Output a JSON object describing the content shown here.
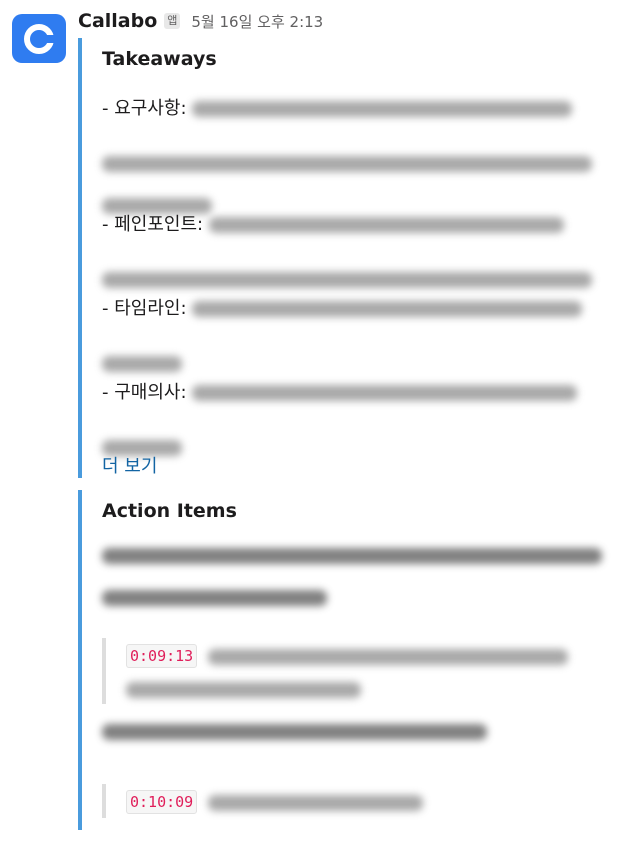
{
  "message": {
    "sender": "Callabo",
    "app_badge": "앱",
    "timestamp": "5월 16일 오후 2:13",
    "accent_color": "#4a9bdd",
    "avatar_icon": "callabo-logo-icon"
  },
  "takeaways": {
    "title": "Takeaways",
    "items": [
      {
        "label": "- 요구사항:"
      },
      {
        "label": "- 페인포인트:"
      },
      {
        "label": "- 타임라인:"
      },
      {
        "label": "- 구매의사:"
      }
    ],
    "more_link": "더 보기"
  },
  "action_items": {
    "title": "Action Items",
    "timecodes": [
      "0:09:13",
      "0:10:09"
    ]
  }
}
